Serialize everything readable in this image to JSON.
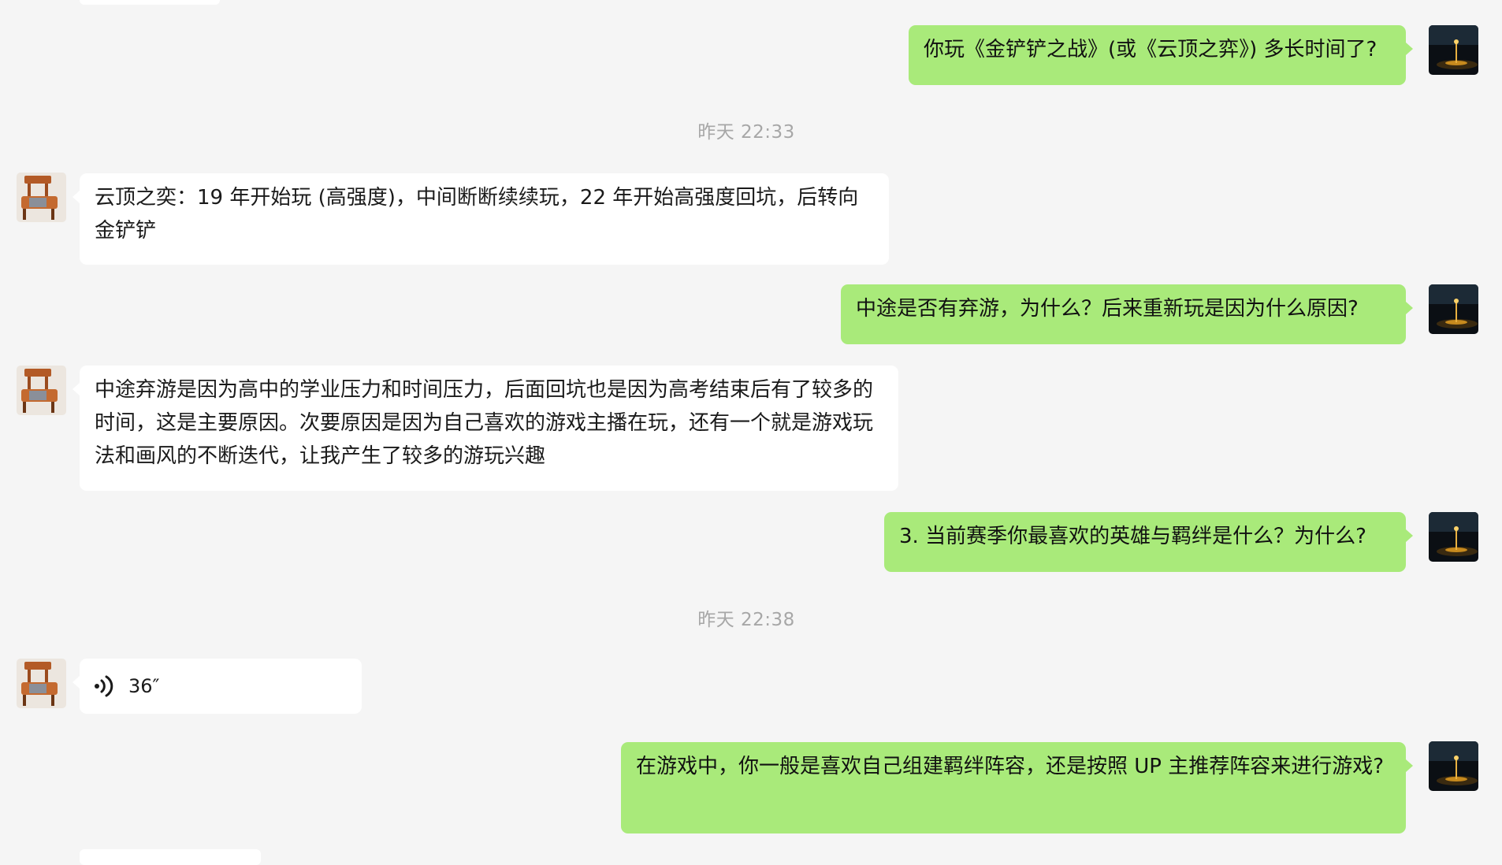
{
  "colors": {
    "background": "#f5f5f5",
    "incoming_bubble": "#ffffff",
    "outgoing_bubble": "#a9ea7a",
    "timestamp": "#a7a7a7"
  },
  "messages": [
    {
      "type": "text",
      "sender": "self",
      "text": "你玩《金铲铲之战》(或《云顶之弈》) 多长时间了?"
    },
    {
      "type": "timestamp",
      "text": "昨天 22:33"
    },
    {
      "type": "text",
      "sender": "other",
      "text": "云顶之奕：19 年开始玩 (高强度)，中间断断续续玩，22 年开始高强度回坑，后转向金铲铲"
    },
    {
      "type": "text",
      "sender": "self",
      "text": "中途是否有弃游，为什么？后来重新玩是因为什么原因?"
    },
    {
      "type": "text",
      "sender": "other",
      "text": "中途弃游是因为高中的学业压力和时间压力，后面回坑也是因为高考结束后有了较多的时间，这是主要原因。次要原因是因为自己喜欢的游戏主播在玩，还有一个就是游戏玩法和画风的不断迭代，让我产生了较多的游玩兴趣"
    },
    {
      "type": "text",
      "sender": "self",
      "text": "3. 当前赛季你最喜欢的英雄与羁绊是什么？为什么?"
    },
    {
      "type": "timestamp",
      "text": "昨天 22:38"
    },
    {
      "type": "voice",
      "sender": "other",
      "duration": "36″",
      "icon": "voice-wave-icon"
    },
    {
      "type": "text",
      "sender": "self",
      "text": "在游戏中，你一般是喜欢自己组建羁绊阵容，还是按照 UP 主推荐阵容来进行游戏?"
    }
  ]
}
